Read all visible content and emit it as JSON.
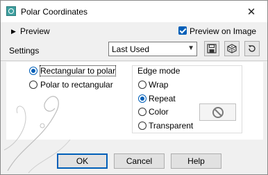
{
  "window": {
    "title": "Polar Coordinates",
    "close_glyph": "✕"
  },
  "preview": {
    "toggle_label": "Preview",
    "preview_on_image_label": "Preview on Image",
    "preview_on_image_checked": true
  },
  "settings": {
    "label": "Settings",
    "preset_value": "Last Used"
  },
  "mode": {
    "options": [
      {
        "label": "Rectangular to polar",
        "selected": true
      },
      {
        "label": "Polar to rectangular",
        "selected": false
      }
    ]
  },
  "edge_mode": {
    "title": "Edge mode",
    "options": [
      {
        "label": "Wrap",
        "selected": false
      },
      {
        "label": "Repeat",
        "selected": true
      },
      {
        "label": "Color",
        "selected": false
      },
      {
        "label": "Transparent",
        "selected": false
      }
    ]
  },
  "buttons": {
    "ok": "OK",
    "cancel": "Cancel",
    "help": "Help"
  },
  "colors": {
    "accent": "#005fb8"
  }
}
